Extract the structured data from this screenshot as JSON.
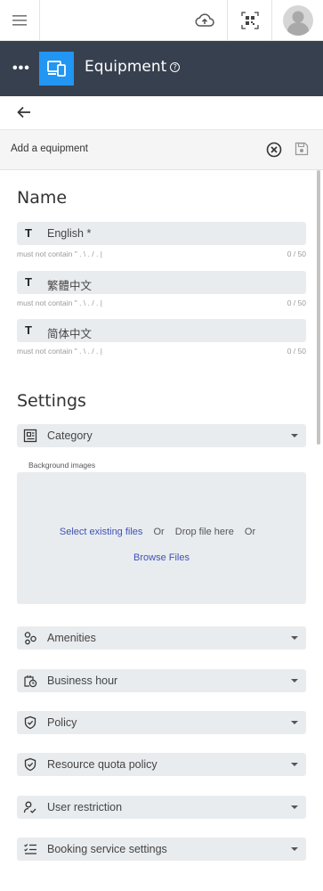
{
  "topbar": {
    "menu_icon": "hamburger-icon",
    "upload_icon": "cloud-upload-icon",
    "qr_icon": "qr-code-icon",
    "avatar_icon": "user-avatar-icon"
  },
  "appbar": {
    "more_icon": "more-horizontal-icon",
    "logo_icon": "devices-icon",
    "title": "Equipment",
    "help_glyph": "?"
  },
  "form": {
    "title": "Add a equipment",
    "close_icon": "close-circle-icon",
    "save_icon": "save-icon"
  },
  "name_section": {
    "heading": "Name",
    "fields": [
      {
        "type_glyph": "T",
        "label": "English *",
        "helper": "must not contain \" . \\ . / . |",
        "count": "0 / 50"
      },
      {
        "type_glyph": "T",
        "label": "繁體中文",
        "helper": "must not contain \" . \\ . / . |",
        "count": "0 / 50"
      },
      {
        "type_glyph": "T",
        "label": "简体中文",
        "helper": "must not contain \" . \\ . / . |",
        "count": "0 / 50"
      }
    ]
  },
  "settings_section": {
    "heading": "Settings",
    "category": {
      "label": "Category",
      "icon": "category-icon"
    },
    "background_images": {
      "label": "Background images",
      "select_existing": "Select existing files",
      "or": "Or",
      "drop_here": "Drop file here",
      "browse": "Browse Files"
    },
    "items": [
      {
        "label": "Amenities",
        "icon": "amenities-icon"
      },
      {
        "label": "Business hour",
        "icon": "business-hour-icon"
      },
      {
        "label": "Policy",
        "icon": "policy-shield-icon"
      },
      {
        "label": "Resource quota policy",
        "icon": "quota-shield-icon"
      },
      {
        "label": "User restriction",
        "icon": "user-restriction-icon"
      },
      {
        "label": "Booking service settings",
        "icon": "booking-settings-icon"
      }
    ]
  },
  "colors": {
    "appbar_bg": "#37404f",
    "logo_bg": "#2196f3",
    "link": "#3f51b5",
    "field_bg": "#e9ecef"
  }
}
